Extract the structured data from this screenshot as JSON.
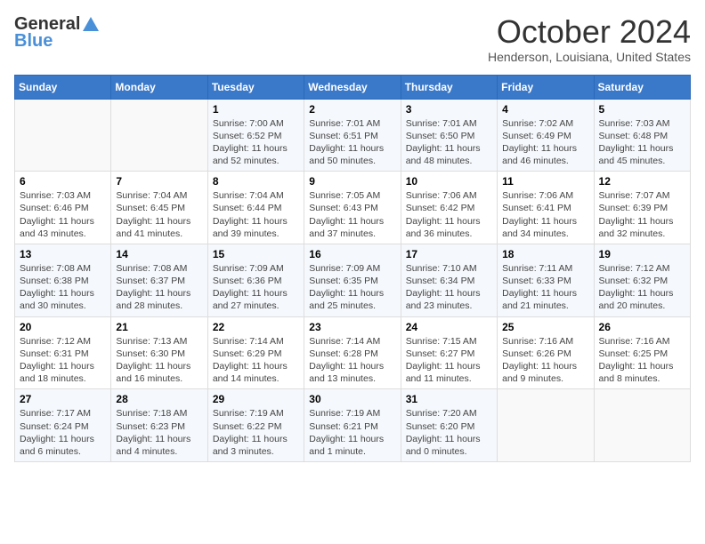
{
  "header": {
    "logo_general": "General",
    "logo_blue": "Blue",
    "title": "October 2024",
    "location": "Henderson, Louisiana, United States"
  },
  "days_of_week": [
    "Sunday",
    "Monday",
    "Tuesday",
    "Wednesday",
    "Thursday",
    "Friday",
    "Saturday"
  ],
  "weeks": [
    [
      {
        "day": "",
        "sunrise": "",
        "sunset": "",
        "daylight": ""
      },
      {
        "day": "",
        "sunrise": "",
        "sunset": "",
        "daylight": ""
      },
      {
        "day": "1",
        "sunrise": "Sunrise: 7:00 AM",
        "sunset": "Sunset: 6:52 PM",
        "daylight": "Daylight: 11 hours and 52 minutes."
      },
      {
        "day": "2",
        "sunrise": "Sunrise: 7:01 AM",
        "sunset": "Sunset: 6:51 PM",
        "daylight": "Daylight: 11 hours and 50 minutes."
      },
      {
        "day": "3",
        "sunrise": "Sunrise: 7:01 AM",
        "sunset": "Sunset: 6:50 PM",
        "daylight": "Daylight: 11 hours and 48 minutes."
      },
      {
        "day": "4",
        "sunrise": "Sunrise: 7:02 AM",
        "sunset": "Sunset: 6:49 PM",
        "daylight": "Daylight: 11 hours and 46 minutes."
      },
      {
        "day": "5",
        "sunrise": "Sunrise: 7:03 AM",
        "sunset": "Sunset: 6:48 PM",
        "daylight": "Daylight: 11 hours and 45 minutes."
      }
    ],
    [
      {
        "day": "6",
        "sunrise": "Sunrise: 7:03 AM",
        "sunset": "Sunset: 6:46 PM",
        "daylight": "Daylight: 11 hours and 43 minutes."
      },
      {
        "day": "7",
        "sunrise": "Sunrise: 7:04 AM",
        "sunset": "Sunset: 6:45 PM",
        "daylight": "Daylight: 11 hours and 41 minutes."
      },
      {
        "day": "8",
        "sunrise": "Sunrise: 7:04 AM",
        "sunset": "Sunset: 6:44 PM",
        "daylight": "Daylight: 11 hours and 39 minutes."
      },
      {
        "day": "9",
        "sunrise": "Sunrise: 7:05 AM",
        "sunset": "Sunset: 6:43 PM",
        "daylight": "Daylight: 11 hours and 37 minutes."
      },
      {
        "day": "10",
        "sunrise": "Sunrise: 7:06 AM",
        "sunset": "Sunset: 6:42 PM",
        "daylight": "Daylight: 11 hours and 36 minutes."
      },
      {
        "day": "11",
        "sunrise": "Sunrise: 7:06 AM",
        "sunset": "Sunset: 6:41 PM",
        "daylight": "Daylight: 11 hours and 34 minutes."
      },
      {
        "day": "12",
        "sunrise": "Sunrise: 7:07 AM",
        "sunset": "Sunset: 6:39 PM",
        "daylight": "Daylight: 11 hours and 32 minutes."
      }
    ],
    [
      {
        "day": "13",
        "sunrise": "Sunrise: 7:08 AM",
        "sunset": "Sunset: 6:38 PM",
        "daylight": "Daylight: 11 hours and 30 minutes."
      },
      {
        "day": "14",
        "sunrise": "Sunrise: 7:08 AM",
        "sunset": "Sunset: 6:37 PM",
        "daylight": "Daylight: 11 hours and 28 minutes."
      },
      {
        "day": "15",
        "sunrise": "Sunrise: 7:09 AM",
        "sunset": "Sunset: 6:36 PM",
        "daylight": "Daylight: 11 hours and 27 minutes."
      },
      {
        "day": "16",
        "sunrise": "Sunrise: 7:09 AM",
        "sunset": "Sunset: 6:35 PM",
        "daylight": "Daylight: 11 hours and 25 minutes."
      },
      {
        "day": "17",
        "sunrise": "Sunrise: 7:10 AM",
        "sunset": "Sunset: 6:34 PM",
        "daylight": "Daylight: 11 hours and 23 minutes."
      },
      {
        "day": "18",
        "sunrise": "Sunrise: 7:11 AM",
        "sunset": "Sunset: 6:33 PM",
        "daylight": "Daylight: 11 hours and 21 minutes."
      },
      {
        "day": "19",
        "sunrise": "Sunrise: 7:12 AM",
        "sunset": "Sunset: 6:32 PM",
        "daylight": "Daylight: 11 hours and 20 minutes."
      }
    ],
    [
      {
        "day": "20",
        "sunrise": "Sunrise: 7:12 AM",
        "sunset": "Sunset: 6:31 PM",
        "daylight": "Daylight: 11 hours and 18 minutes."
      },
      {
        "day": "21",
        "sunrise": "Sunrise: 7:13 AM",
        "sunset": "Sunset: 6:30 PM",
        "daylight": "Daylight: 11 hours and 16 minutes."
      },
      {
        "day": "22",
        "sunrise": "Sunrise: 7:14 AM",
        "sunset": "Sunset: 6:29 PM",
        "daylight": "Daylight: 11 hours and 14 minutes."
      },
      {
        "day": "23",
        "sunrise": "Sunrise: 7:14 AM",
        "sunset": "Sunset: 6:28 PM",
        "daylight": "Daylight: 11 hours and 13 minutes."
      },
      {
        "day": "24",
        "sunrise": "Sunrise: 7:15 AM",
        "sunset": "Sunset: 6:27 PM",
        "daylight": "Daylight: 11 hours and 11 minutes."
      },
      {
        "day": "25",
        "sunrise": "Sunrise: 7:16 AM",
        "sunset": "Sunset: 6:26 PM",
        "daylight": "Daylight: 11 hours and 9 minutes."
      },
      {
        "day": "26",
        "sunrise": "Sunrise: 7:16 AM",
        "sunset": "Sunset: 6:25 PM",
        "daylight": "Daylight: 11 hours and 8 minutes."
      }
    ],
    [
      {
        "day": "27",
        "sunrise": "Sunrise: 7:17 AM",
        "sunset": "Sunset: 6:24 PM",
        "daylight": "Daylight: 11 hours and 6 minutes."
      },
      {
        "day": "28",
        "sunrise": "Sunrise: 7:18 AM",
        "sunset": "Sunset: 6:23 PM",
        "daylight": "Daylight: 11 hours and 4 minutes."
      },
      {
        "day": "29",
        "sunrise": "Sunrise: 7:19 AM",
        "sunset": "Sunset: 6:22 PM",
        "daylight": "Daylight: 11 hours and 3 minutes."
      },
      {
        "day": "30",
        "sunrise": "Sunrise: 7:19 AM",
        "sunset": "Sunset: 6:21 PM",
        "daylight": "Daylight: 11 hours and 1 minute."
      },
      {
        "day": "31",
        "sunrise": "Sunrise: 7:20 AM",
        "sunset": "Sunset: 6:20 PM",
        "daylight": "Daylight: 11 hours and 0 minutes."
      },
      {
        "day": "",
        "sunrise": "",
        "sunset": "",
        "daylight": ""
      },
      {
        "day": "",
        "sunrise": "",
        "sunset": "",
        "daylight": ""
      }
    ]
  ]
}
